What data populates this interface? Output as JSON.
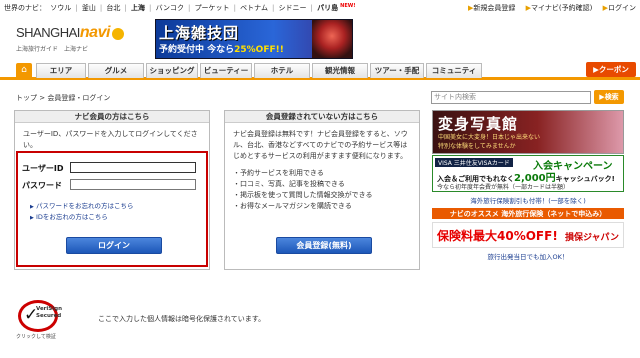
{
  "topbar": {
    "city_prefix": "世界のナビ：",
    "cities": [
      "ソウル",
      "釜山",
      "台北",
      "上海",
      "バンコク",
      "プーケット",
      "ベトナム",
      "シドニー",
      "パリ島"
    ],
    "new_badge": "NEW!",
    "right_links": [
      "新規会員登録",
      "マイナビ(予約確認)",
      "ログイン"
    ]
  },
  "logo": {
    "word": "SHANGHAI",
    "navi": "navi",
    "sub": "上海旅行ガイド　上海ナビ"
  },
  "banner": {
    "title": "上海雑技団",
    "subtitle_pre": "予約受付中 今なら",
    "subtitle_em": "25%OFF!!"
  },
  "nav": {
    "home_icon": "house-icon",
    "tabs": [
      "エリア",
      "グルメ",
      "ショッピング",
      "ビューティー",
      "ホテル",
      "観光情報",
      "ツアー・手配",
      "コミュニティ"
    ],
    "coupon": "クーポン"
  },
  "breadcrumb": {
    "home": "トップ",
    "sep": ">",
    "current": "会員登録・ログイン"
  },
  "search": {
    "placeholder": "サイト内検索",
    "button": "検索"
  },
  "login_panel": {
    "title": "ナビ会員の方はこちら",
    "desc": "ユーザーID、パスワードを入力してログインしてください。",
    "user_label": "ユーザーID",
    "user_value": "",
    "pass_label": "パスワード",
    "pass_value": "",
    "forgot_password": "パスワードをお忘れの方はこちら",
    "forgot_id": "IDをお忘れの方はこちら",
    "login_button": "ログイン"
  },
  "register_panel": {
    "title": "会員登録されていない方はこちら",
    "desc": "ナビ会員登録は無料です！ナビ会員登録をすると、ソウル、台北、香港などすべてのナビでの予約サービス等はじめとするサービスの利用がますます便利になります。",
    "benefits": [
      "・予約サービスを利用できる",
      "・口コミ、写真、記事を投稿できる",
      "・掲示板を使って質問した情報交換ができる",
      "・お得なメールマガジンを購読できる"
    ],
    "register_button": "会員登録(無料)"
  },
  "ads": {
    "photo_title": "変身写真館",
    "photo_sub1": "中国美女に大変身！日本じゃ出来ない",
    "photo_sub2": "特別な体験をしてみませんか",
    "visa_tag": "VISA 三井住友VISAカード",
    "visa_campaign": "入会キャンペーン",
    "visa_mid_pre": "入会＆ご利用でもれなく",
    "visa_mid_em": "2,000円",
    "visa_mid_post": "キャッシュバック!",
    "visa_bot": "今なら初年度年会費が無料（一部カードは半額）",
    "insurance_caption": "海外旅行保険割引も付帯！(一部を除く)",
    "recommend": "ナビのオススメ 海外旅行保険（ネットで申込み）",
    "insurance_pct": "保険料最大40%OFF!",
    "insurance_brand": "損保ジャパン",
    "insurance_foot": "旅行出発当日でも加入OK！"
  },
  "footer": {
    "verisign_line1": "VeriSign",
    "verisign_line2": "Secured",
    "verisign_click": "クリックして検証",
    "note": "ここで入力した個人情報は暗号化保護されています。"
  },
  "colors": {
    "accent": "#f39800",
    "login_border": "#c80000",
    "button_blue": "#1d57b8"
  }
}
